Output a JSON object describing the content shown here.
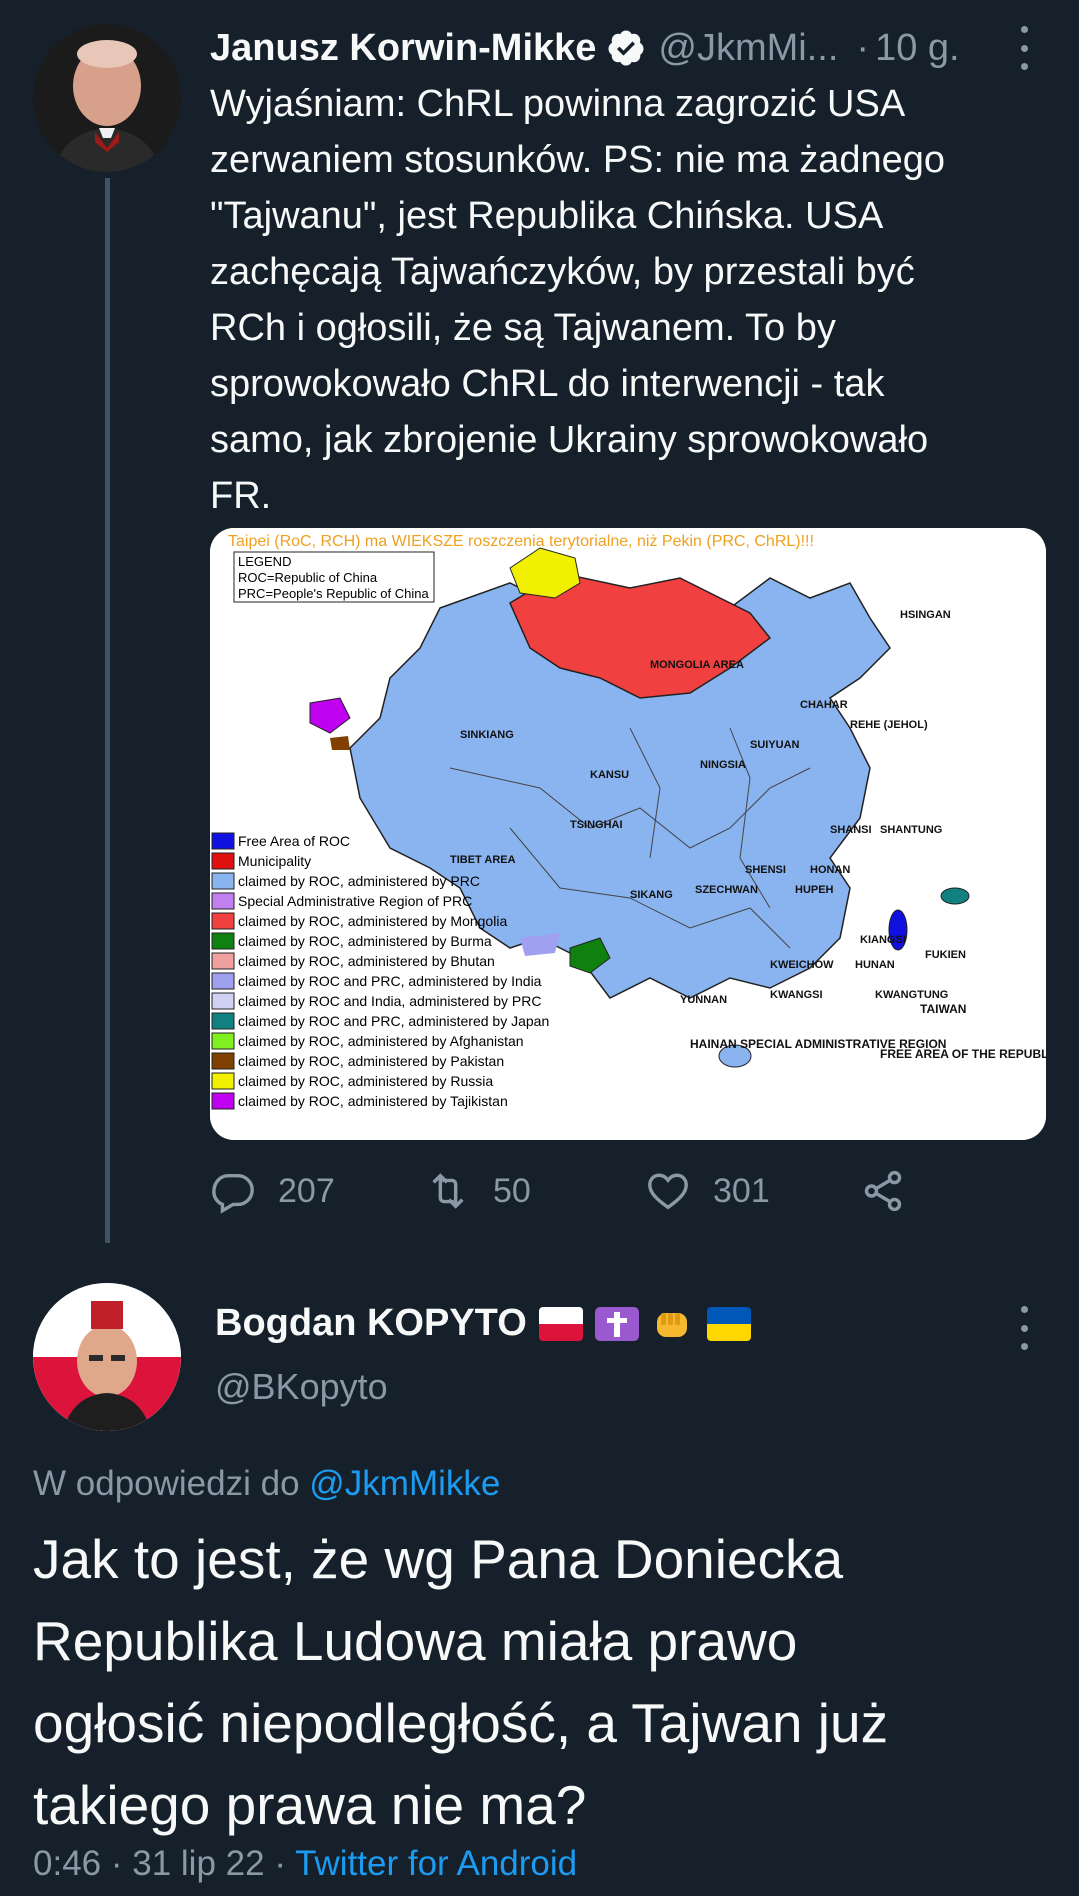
{
  "tweet1": {
    "author_name": "Janusz Korwin-Mikke",
    "handle": "@JkmMi...",
    "time": "10 g.",
    "text_lines": [
      "Wyjaśniam: ChRL powinna zagrozić USA",
      "zerwaniem stosunków. PS: nie ma żadnego",
      "\"Tajwanu\", jest Republika Chińska. USA",
      "zachęcają Tajwańczyków, by przestali być",
      "RCh i ogłosili, że są Tajwanem. To by",
      "sprowokowało ChRL do interwencji - tak",
      "samo, jak zbrojenie Ukrainy sprowokowało",
      "FR."
    ],
    "map": {
      "title": "Taipei (RoC, RCH) ma WIEKSZE roszczenia terytorialne, niż Pekin (PRC, ChRL)!!!",
      "legend_title": "LEGEND",
      "legend_lines": [
        "ROC=Republic of China",
        "PRC=People's Republic of China"
      ],
      "key": [
        {
          "color": "#1010e0",
          "label": "Free Area of ROC"
        },
        {
          "color": "#e01010",
          "label": "Municipality"
        },
        {
          "color": "#8ab4f0",
          "label": "claimed by ROC, administered by PRC"
        },
        {
          "color": "#c080f0",
          "label": "Special Administrative Region of PRC"
        },
        {
          "color": "#f04040",
          "label": "claimed by ROC, administered by Mongolia"
        },
        {
          "color": "#108010",
          "label": "claimed by ROC, administered by Burma"
        },
        {
          "color": "#f0a0a0",
          "label": "claimed by ROC, administered by Bhutan"
        },
        {
          "color": "#a0a0f0",
          "label": "claimed by ROC and PRC, administered by India"
        },
        {
          "color": "#d0d0f0",
          "label": "claimed by ROC and India, administered by PRC"
        },
        {
          "color": "#108080",
          "label": "claimed by ROC and PRC, administered by Japan"
        },
        {
          "color": "#80f020",
          "label": "claimed by ROC, administered by Afghanistan"
        },
        {
          "color": "#804000",
          "label": "claimed by ROC, administered by Pakistan"
        },
        {
          "color": "#f0f000",
          "label": "claimed by ROC, administered by Russia"
        },
        {
          "color": "#c000f0",
          "label": "claimed by ROC, administered by Tajikistan"
        }
      ],
      "region_labels": [
        "SINKIANG",
        "MONGOLIA AREA",
        "TIBET AREA",
        "TSINGHAI",
        "KANSU",
        "NINGSIA",
        "SUIYUAN",
        "CHAHAR",
        "HSINGAN",
        "REHE (JEHOL)",
        "SIKANG",
        "SZECHWAN",
        "SHENSI",
        "HONAN",
        "HUPEH",
        "YUNNAN",
        "KWEICHOW",
        "HUNAN",
        "KWANGSI",
        "KWANGTUNG",
        "FUKIEN",
        "KIANGSI",
        "SHANSI",
        "SHANTUNG",
        "TAIWAN",
        "HAINAN SPECIAL ADMINISTRATIVE REGION",
        "FREE AREA OF THE REPUBLIC OF CHINA"
      ]
    },
    "actions": {
      "replies": "207",
      "retweets": "50",
      "likes": "301"
    }
  },
  "tweet2": {
    "author_name": "Bogdan KOPYTO",
    "handle": "@BKopyto",
    "reply_prefix": "W odpowiedzi do",
    "reply_handle": "@JkmMikke",
    "text_lines": [
      "Jak to jest, że wg Pana Doniecka",
      "Republika Ludowa miała prawo",
      "ogłosić niepodległość, a Tajwan już",
      "takiego prawa nie ma?"
    ],
    "time": "0:46",
    "date": "31 lip 22",
    "source": "Twitter for Android"
  },
  "colors": {
    "background": "#15202b",
    "text": "#f7f9f9",
    "muted": "#8b98a5",
    "accent": "#1d9bf0"
  }
}
